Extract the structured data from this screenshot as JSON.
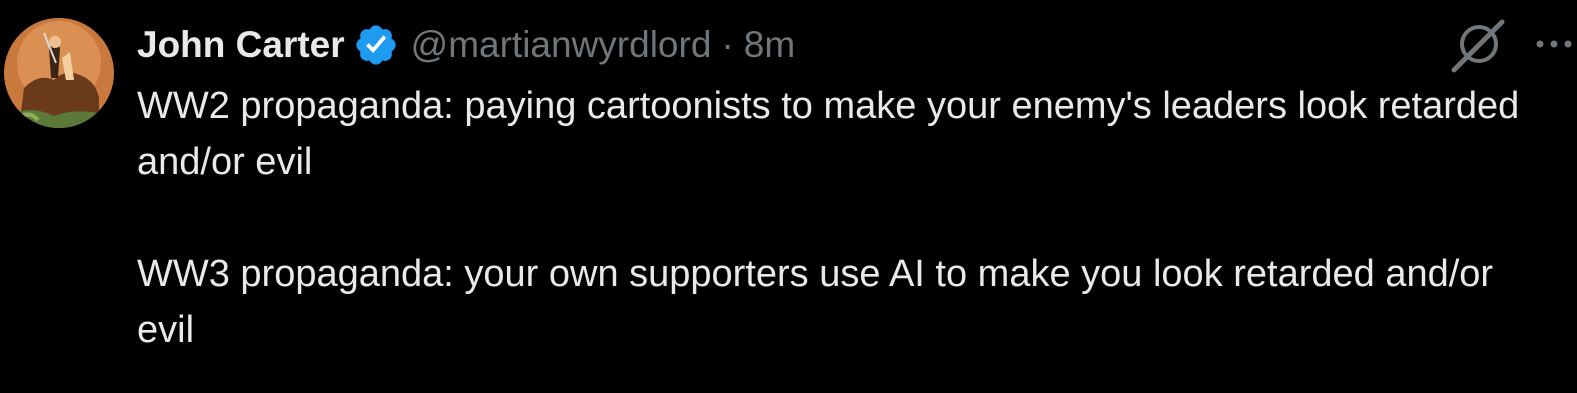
{
  "tweet": {
    "author_name": "John Carter",
    "handle": "@martianwyrdlord",
    "separator": "·",
    "timestamp": "8m",
    "verified": true,
    "paragraphs": [
      "WW2 propaganda: paying cartoonists to make your enemy's leaders look retarded and/or evil",
      "WW3 propaganda: your own supporters use AI to make you look retarded and/or evil"
    ],
    "icons": {
      "verified": "verified-badge-icon",
      "grok": "grok-icon",
      "more": "more-options-icon"
    }
  },
  "colors": {
    "background": "#000000",
    "text_primary": "#e7e9ea",
    "text_secondary": "#71767b",
    "verified_blue": "#1d9bf0"
  }
}
